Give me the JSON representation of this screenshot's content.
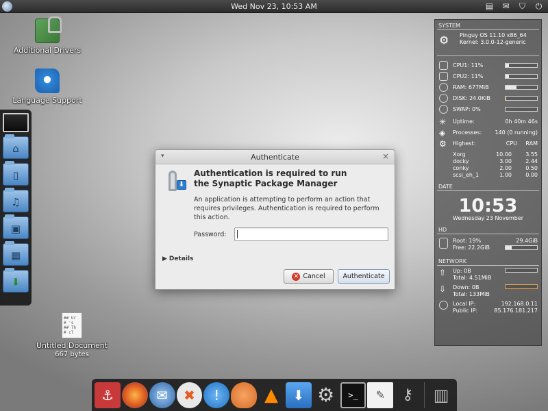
{
  "top_panel": {
    "clock": "Wed Nov 23, 10:53 AM"
  },
  "desktop": {
    "icons": [
      {
        "label": "Additional Drivers"
      },
      {
        "label": "Language Support"
      },
      {
        "label": "Untitled Document",
        "sub": "667 bytes",
        "preview": "## Ur\n# 's\n## Th\n# cl"
      }
    ]
  },
  "conky": {
    "system_title": "SYSTEM",
    "os": "Pinguy OS 11.10 x86_64",
    "kernel": "Kernel: 3.0.0-12-generic",
    "cpu1": {
      "label": "CPU1: 11%",
      "value": 0.11
    },
    "cpu2": {
      "label": "CPU2: 11%",
      "value": 0.11
    },
    "ram": {
      "label": "RAM: 677MiB",
      "value": 0.34
    },
    "disk": {
      "label": "DISK: 24.0KiB",
      "value": 0.02
    },
    "swap": {
      "label": "SWAP: 0%",
      "value": 0
    },
    "uptime_label": "Uptime:",
    "uptime_value": "0h 40m 46s",
    "processes_label": "Processes:",
    "processes_value": "140 (0 running)",
    "highest_label": "Highest:",
    "highest_cols": [
      "CPU",
      "RAM"
    ],
    "highest_rows": [
      {
        "name": "Xorg",
        "cpu": "10.00",
        "ram": "3.55"
      },
      {
        "name": "docky",
        "cpu": "3.00",
        "ram": "2.44"
      },
      {
        "name": "conky",
        "cpu": "2.00",
        "ram": "0.50"
      },
      {
        "name": "scsi_eh_1",
        "cpu": "1.00",
        "ram": "0.00"
      }
    ],
    "date_title": "DATE",
    "time": "10:53",
    "date": "Wednesday 23 November",
    "hd_title": "HD",
    "root": "Root: 19%",
    "root_size": "29.4GiB",
    "free": "Free: 22.2GiB",
    "hd_usage": 0.19,
    "network_title": "NETWORK",
    "up": "Up: 0B",
    "up_total": "Total: 4.51MiB",
    "down": "Down: 0B",
    "down_total": "Total: 133MiB",
    "local_ip_label": "Local IP:",
    "local_ip": "192.168.0.11",
    "public_ip_label": "Public IP:",
    "public_ip": "85.176.181.217"
  },
  "dialog": {
    "title": "Authenticate",
    "heading_line1": "Authentication is required to run",
    "heading_line2": "the Synaptic Package Manager",
    "body": "An application is attempting to perform an action that requires privileges. Authentication is required to perform this action.",
    "password_label": "Password:",
    "password_value": "",
    "details_label": "Details",
    "cancel_label": "Cancel",
    "authenticate_label": "Authenticate"
  },
  "bottom_dock": {
    "items": [
      "anchor-icon",
      "firefox-icon",
      "thunderbird-icon",
      "xchat-icon",
      "notification-icon",
      "pidgin-icon",
      "vlc-icon",
      "download-icon",
      "settings-gear-icon",
      "terminal-icon",
      "text-editor-icon",
      "keys-icon",
      "trash-icon"
    ]
  }
}
